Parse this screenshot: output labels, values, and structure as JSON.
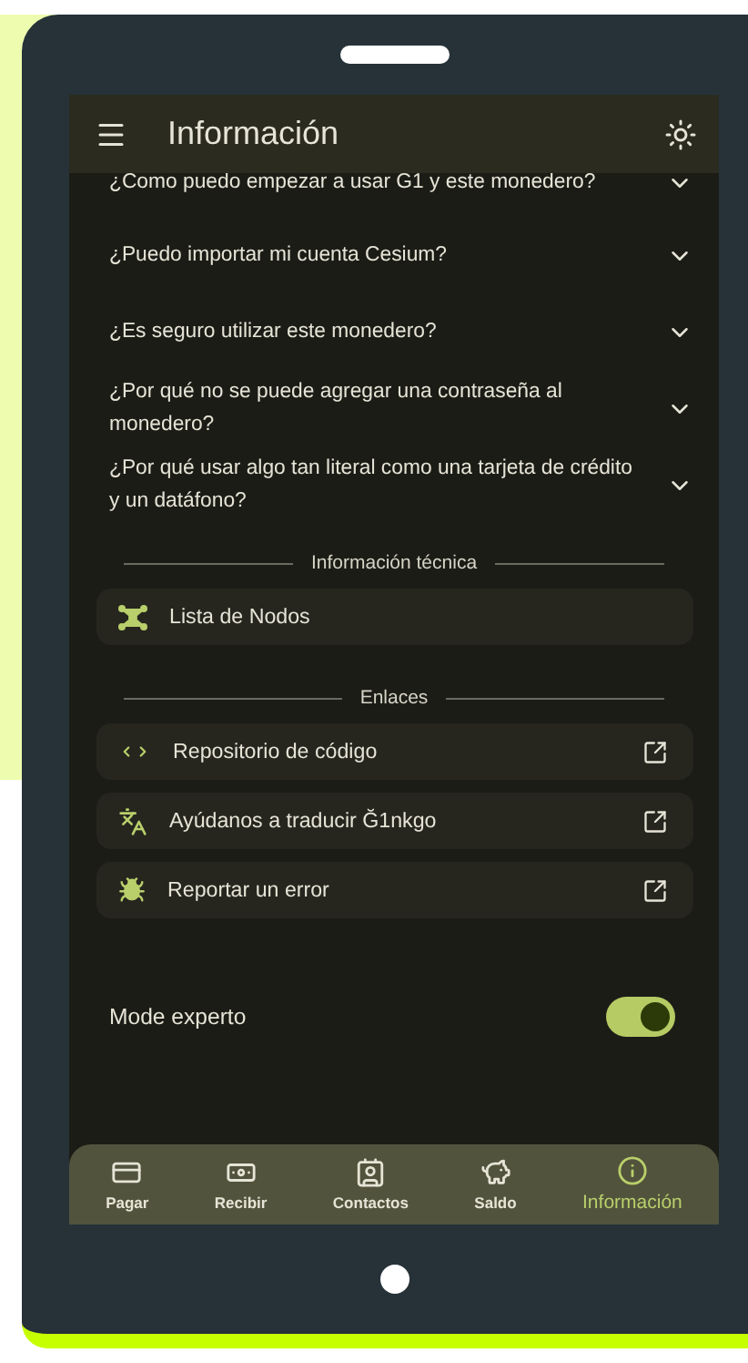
{
  "app_bar": {
    "title": "Información"
  },
  "faq": [
    {
      "question": "¿Como puedo empezar a usar G1 y este monedero?"
    },
    {
      "question": "¿Puedo importar mi cuenta Cesium?"
    },
    {
      "question": "¿Es seguro utilizar este monedero?"
    },
    {
      "question": "¿Por qué no se puede agregar una contraseña al monedero?"
    },
    {
      "question": "¿Por qué usar algo tan literal como una tarjeta de crédito y un datáfono?"
    }
  ],
  "sections": [
    {
      "title": "Información técnica",
      "items": [
        {
          "label": "Lista de Nodos",
          "kind": "nodes",
          "external": false
        }
      ]
    },
    {
      "title": "Enlaces",
      "items": [
        {
          "label": "Repositorio de código",
          "kind": "code",
          "external": true
        },
        {
          "label": "Ayúdanos a traducir Ğ1nkgo",
          "kind": "translate",
          "external": true
        },
        {
          "label": "Reportar un error",
          "kind": "bug",
          "external": true
        }
      ]
    }
  ],
  "expert_mode": {
    "label": "Mode experto",
    "on": true
  },
  "nav": [
    {
      "label": "Pagar",
      "kind": "card",
      "selected": false
    },
    {
      "label": "Recibir",
      "kind": "cash",
      "selected": false
    },
    {
      "label": "Contactos",
      "kind": "contact",
      "selected": false
    },
    {
      "label": "Saldo",
      "kind": "piggy",
      "selected": false
    },
    {
      "label": "Información",
      "kind": "info",
      "selected": true
    }
  ]
}
